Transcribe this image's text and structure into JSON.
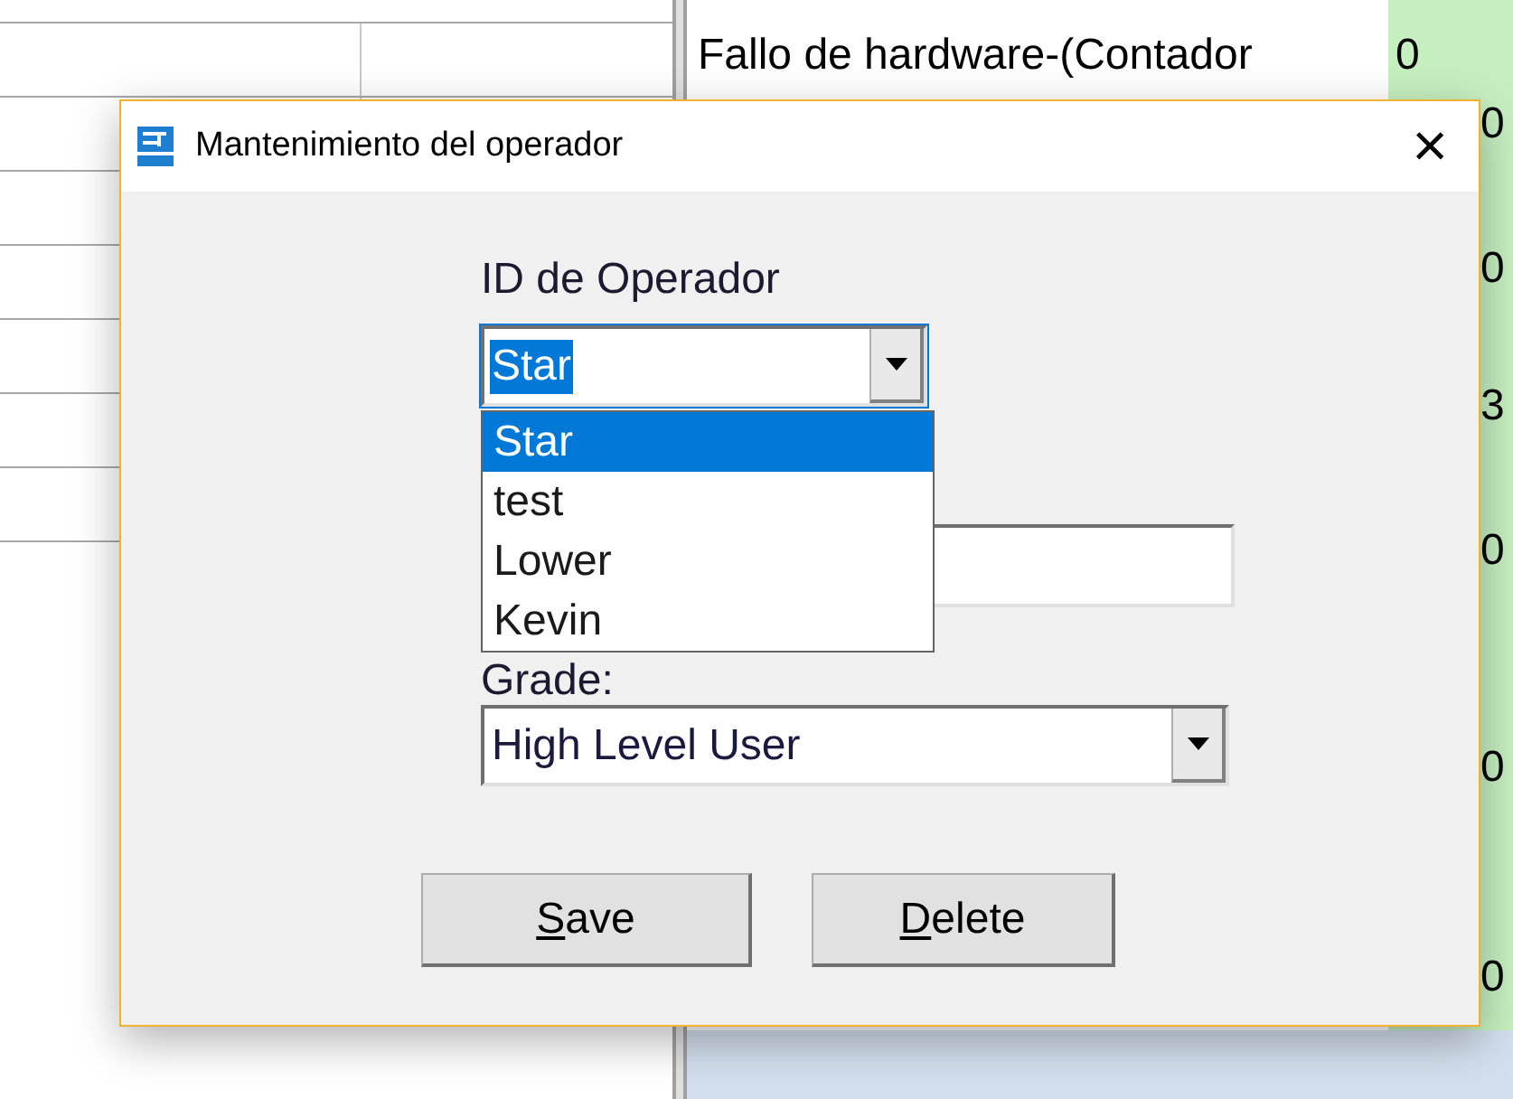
{
  "background": {
    "label": "Fallo de hardware-(Contador",
    "values": [
      "0",
      "0",
      "0",
      "3",
      "0",
      "0",
      "0"
    ]
  },
  "dialog": {
    "title": "Mantenimiento del operador",
    "close": "×",
    "operator_label": "ID de Operador",
    "operator_combo": {
      "value": "Star",
      "highlighted": true,
      "expanded": true
    },
    "operator_options": [
      {
        "label": "Star",
        "selected": true
      },
      {
        "label": "test",
        "selected": false
      },
      {
        "label": "Lower",
        "selected": false
      },
      {
        "label": "Kevin",
        "selected": false
      }
    ],
    "grade_label": "Grade:",
    "grade_combo": {
      "value": "High Level User",
      "highlighted": false,
      "expanded": false
    },
    "buttons": [
      {
        "label": "Save"
      },
      {
        "label": "Delete"
      }
    ]
  }
}
